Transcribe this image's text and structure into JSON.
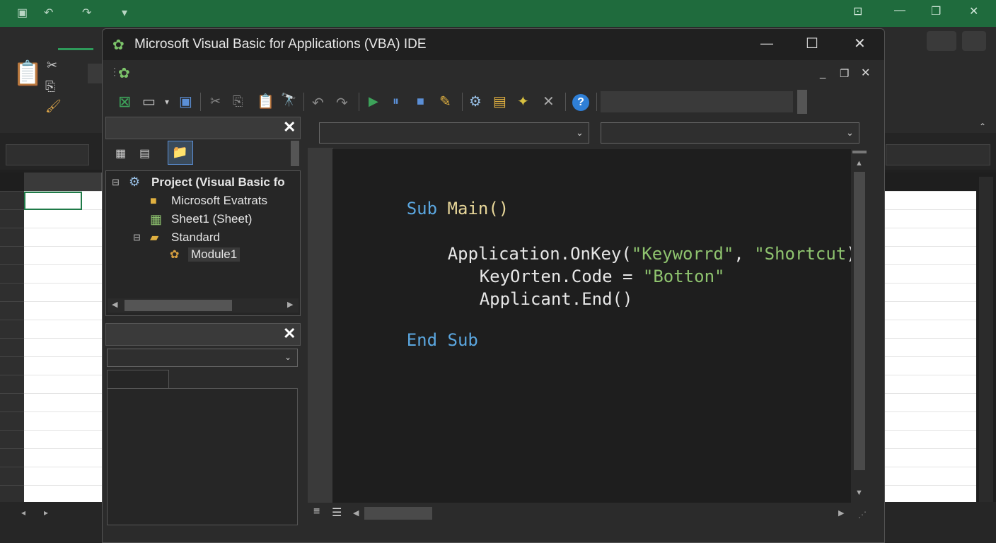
{
  "window": {
    "title": "Microsoft Visual Basic for Applications (VBA) IDE",
    "minimize_glyph": "—",
    "maximize_glyph": "☐",
    "close_glyph": "✕"
  },
  "project_explorer": {
    "close_glyph": "✕",
    "items": [
      {
        "label": "Project (Visual Basic fo",
        "icon": "project-icon"
      },
      {
        "label": "Microsoft Evatrats",
        "icon": "folder-icon"
      },
      {
        "label": "Sheet1 (Sheet)",
        "icon": "sheet-icon"
      },
      {
        "label": "Standard",
        "icon": "folder-open-icon"
      },
      {
        "label": "Module1",
        "icon": "module-icon"
      }
    ]
  },
  "properties": {
    "close_glyph": "✕"
  },
  "code": {
    "sub_kw": "Sub",
    "sub_name": "Main()",
    "line2_a": "Application.OnKey(",
    "line2_s1": "\"Keyworrd\"",
    "line2_b": ", ",
    "line2_s2": "\"Shortcut",
    "line2_c": ")",
    "line3_a": "KeyOrten.Code = ",
    "line3_s": "\"Botton\"",
    "line4": "Applicant.End()",
    "end_kw": "End Sub"
  },
  "colors": {
    "excel_green": "#1f6b3d",
    "keyword": "#5ba7e0",
    "string": "#8fc46f",
    "identifier": "#e8d79a"
  }
}
